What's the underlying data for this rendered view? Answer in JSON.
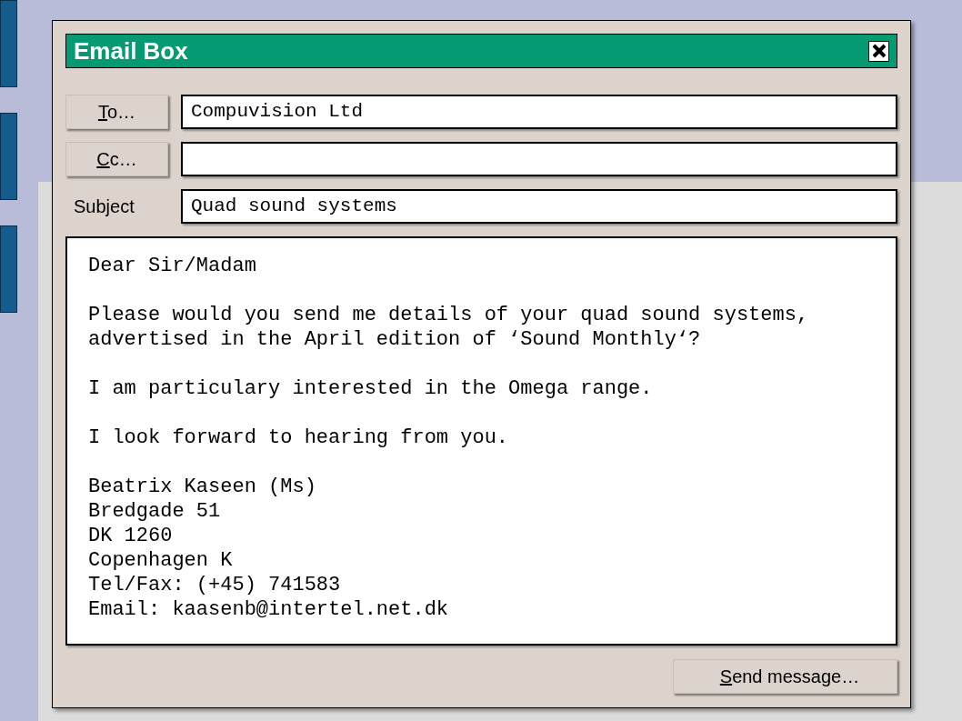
{
  "window": {
    "title": "Email Box"
  },
  "fields": [
    {
      "kind": "button",
      "label": "To…",
      "value": "Compuvision Ltd"
    },
    {
      "kind": "button",
      "label": "Cc…"
    },
    {
      "kind": "label",
      "label": "Subject",
      "value": "Quad sound systems"
    }
  ],
  "body": {
    "paragraphs": [
      "Dear Sir/Madam",
      "Please would you send me details of your quad sound systems,\nadvertised in the April edition of ‘Sound Monthly‘?",
      "I am particulary interested in the Omega range.",
      "I look forward to hearing from you.",
      "Beatrix Kaseen (Ms)\nBredgade 51\nDK 1260\nCopenhagen K\nTel/Fax: (+45) 741583\nEmail: kaasenb@intertel.net.dk"
    ]
  },
  "send_button": "Send message…"
}
